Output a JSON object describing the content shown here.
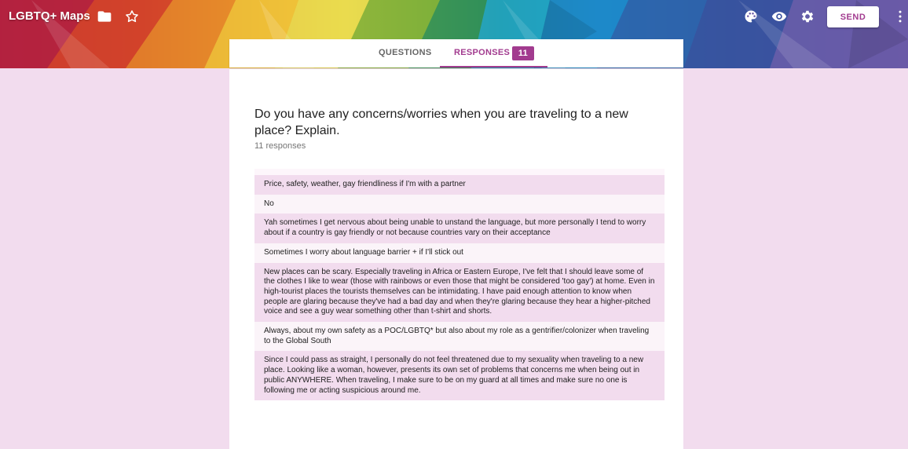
{
  "app": {
    "title": "LGBTQ+ Maps"
  },
  "icons": {
    "folder": "folder-icon",
    "star": "star-icon",
    "palette": "palette-icon",
    "preview": "eye-icon",
    "settings": "gear-icon",
    "more": "more-vert-icon"
  },
  "toolbar": {
    "send_label": "SEND"
  },
  "tabs": {
    "questions": "QUESTIONS",
    "responses": "RESPONSES",
    "responses_count": "11"
  },
  "question": {
    "title": "Do you have any concerns/worries when you are traveling to a new place? Explain.",
    "count_label": "11 responses"
  },
  "responses": [
    "Price, safety, weather, gay friendliness if I'm with a partner",
    "No",
    "Yah sometimes I get nervous about being unable to unstand the language, but more personally I tend to worry about if a country is gay friendly or not because countries vary on their acceptance",
    "Sometimes I worry about language barrier + if I'll stick out",
    "New places can be scary. Especially traveling in Africa or Eastern Europe, I've felt that I should leave some of the clothes I like to wear (those with rainbows or even those that might be considered 'too gay') at home. Even in high-tourist places the tourists themselves can be intimidating. I have paid enough attention to know when people are glaring because they've had a bad day and when they're glaring because they hear a higher-pitched voice and see a guy wear something other than t-shirt and shorts.",
    "Always, about my own safety as a POC/LGBTQ* but also about my role as a gentrifier/colonizer when traveling to the Global South",
    "Since I could pass as straight, I personally do not feel threatened due to my sexuality when traveling to a new place. Looking like a woman, however, presents its own set of problems that concerns me when being out in public ANYWHERE. When traveling, I make sure to be on my guard at all times and make sure no one is following me or acting suspicious around me."
  ],
  "colors": {
    "accent": "#a23b8f",
    "page_background": "#f2dcee",
    "row_tint": "#f2dcee"
  }
}
